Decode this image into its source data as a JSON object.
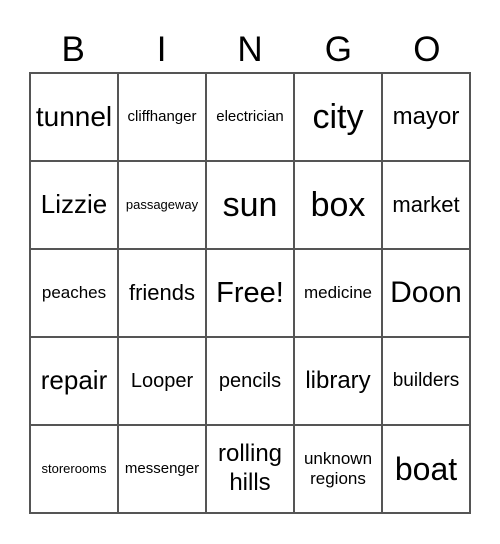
{
  "header": [
    "B",
    "I",
    "N",
    "G",
    "O"
  ],
  "cells": [
    [
      "tunnel",
      "cliffhanger",
      "electrician",
      "city",
      "mayor"
    ],
    [
      "Lizzie",
      "passageway",
      "sun",
      "box",
      "market"
    ],
    [
      "peaches",
      "friends",
      "Free!",
      "medicine",
      "Doon"
    ],
    [
      "repair",
      "Looper",
      "pencils",
      "library",
      "builders"
    ],
    [
      "storerooms",
      "messenger",
      "rolling hills",
      "unknown regions",
      "boat"
    ]
  ]
}
